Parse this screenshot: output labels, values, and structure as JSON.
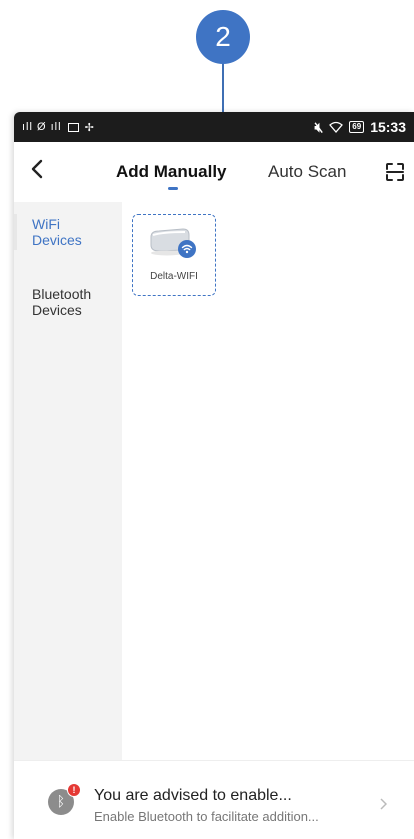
{
  "callout": {
    "number": "2",
    "color": "#3f74c4"
  },
  "status_bar": {
    "left_text": "ıll Ø ıll",
    "time": "15:33",
    "battery": "69"
  },
  "nav": {
    "back_icon": "chevron-left-icon",
    "tabs": [
      {
        "label": "Add Manually",
        "active": true
      },
      {
        "label": "Auto Scan",
        "active": false
      }
    ],
    "scan_icon": "scan-icon"
  },
  "sidebar": {
    "items": [
      {
        "label": "WiFi\nDevices",
        "active": true
      },
      {
        "label": "Bluetooth\nDevices",
        "active": false
      }
    ]
  },
  "devices": [
    {
      "name": "Delta-WIFI",
      "icon": "wifi-device-icon"
    }
  ],
  "banner": {
    "title": "You are advised to enable...",
    "subtitle": "Enable Bluetooth to facilitate addition...",
    "badge": "!"
  },
  "colors": {
    "accent": "#3f74c4",
    "badge": "#e53935"
  }
}
